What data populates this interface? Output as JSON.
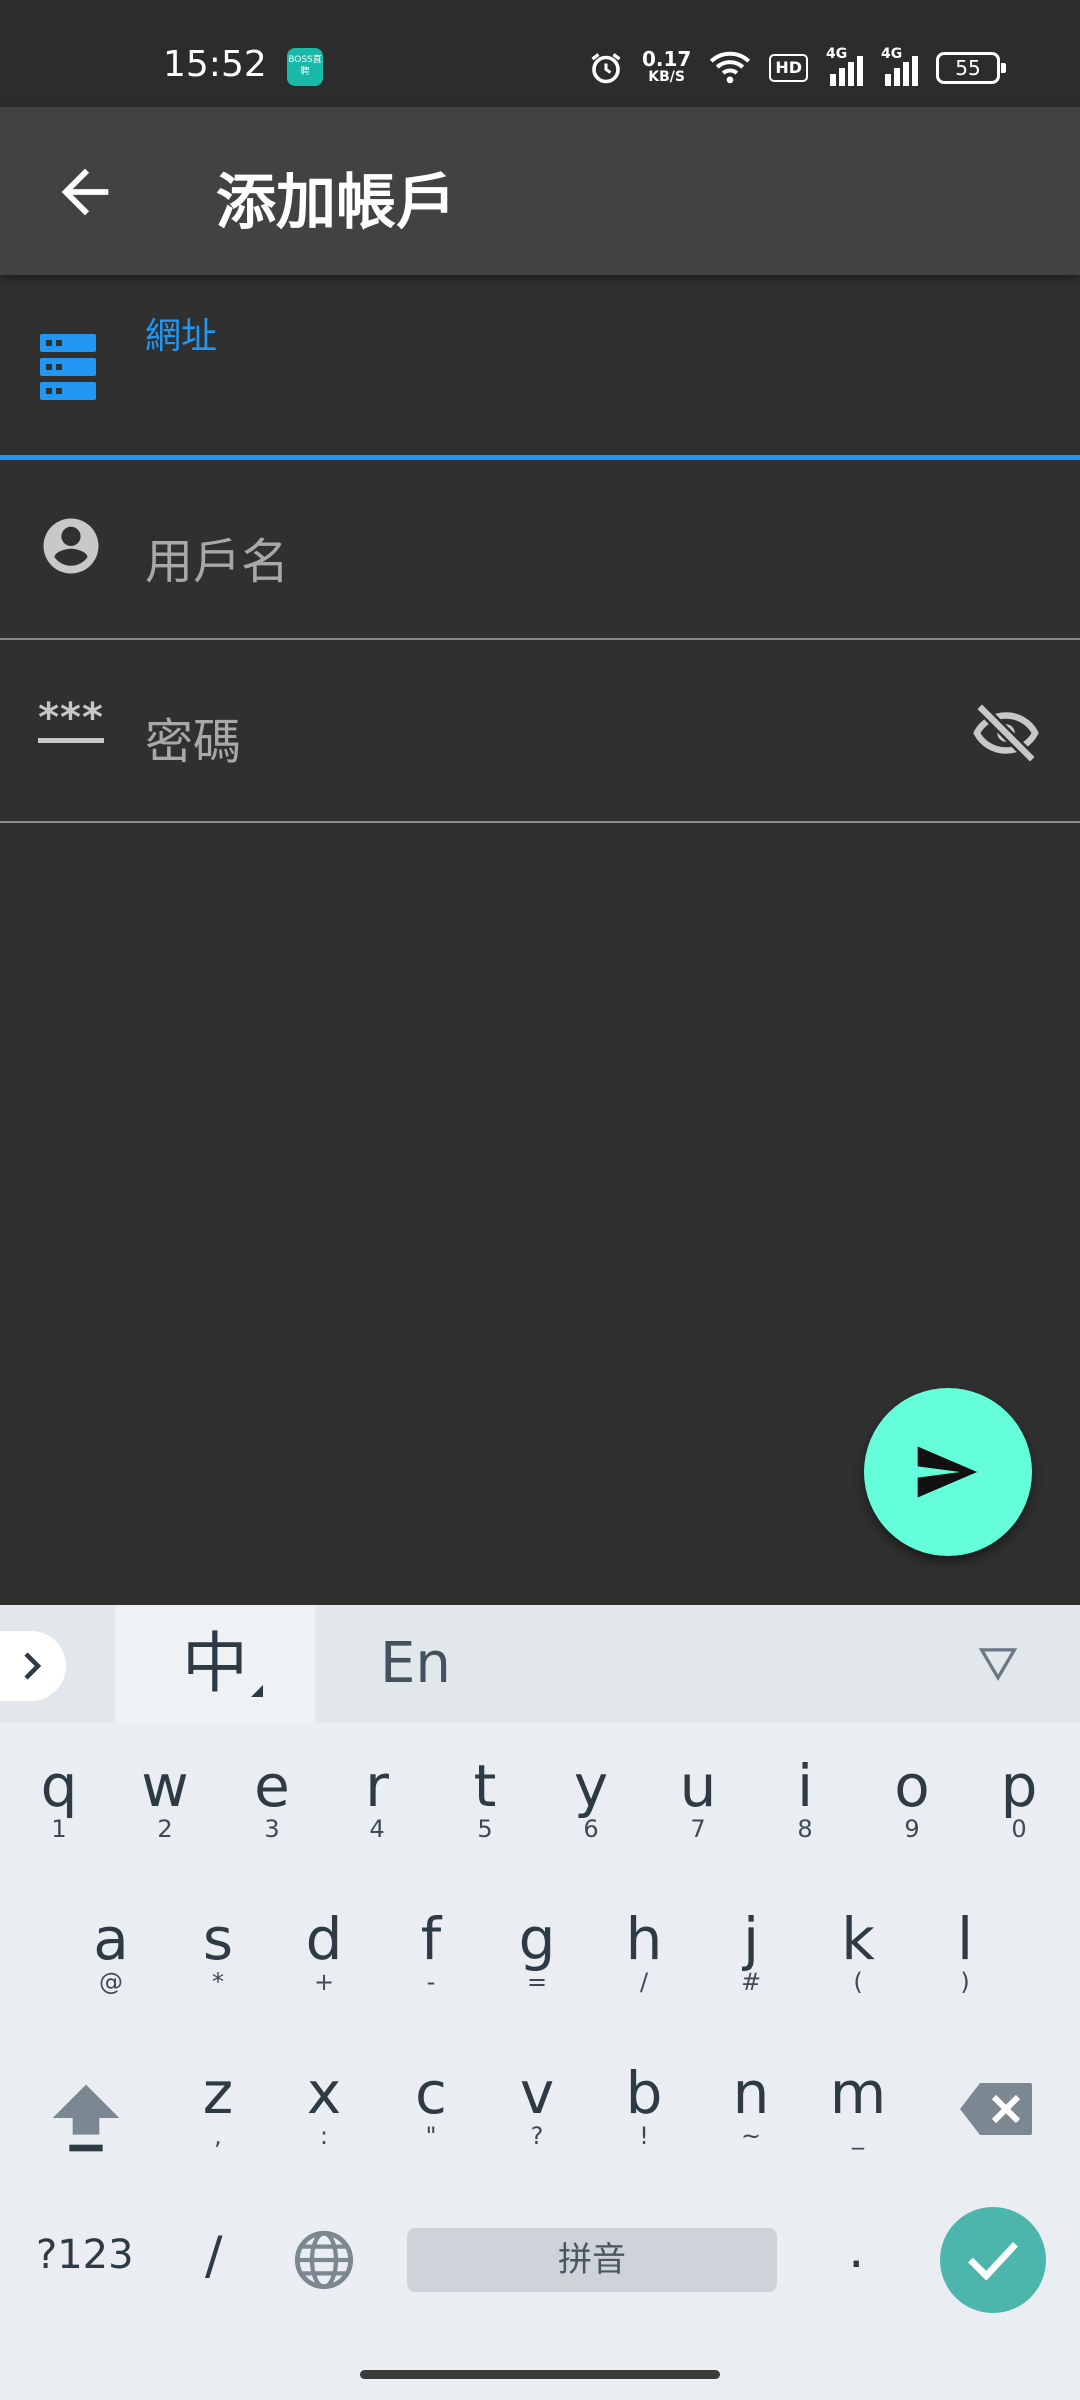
{
  "status_bar": {
    "time": "15:52",
    "app_icon_text": "BOSS直聘",
    "net_speed_value": "0.17",
    "net_speed_unit": "KB/S",
    "hd_label": "HD",
    "signal1_label": "4G",
    "signal2_label": "4G",
    "battery": "55"
  },
  "app_bar": {
    "title": "添加帳戶",
    "back_icon": "arrow-left-icon"
  },
  "form": {
    "url_label": "網址",
    "url_value": "",
    "username_placeholder": "用戶名",
    "password_placeholder": "密碼",
    "password_icon_text": "***",
    "accent_color": "#2196f3"
  },
  "fab": {
    "icon": "send-icon",
    "color": "#64ffda"
  },
  "keyboard": {
    "mode_zh": "中",
    "mode_en": "En",
    "row1": [
      {
        "key": "q",
        "sub": "1"
      },
      {
        "key": "w",
        "sub": "2"
      },
      {
        "key": "e",
        "sub": "3"
      },
      {
        "key": "r",
        "sub": "4"
      },
      {
        "key": "t",
        "sub": "5"
      },
      {
        "key": "y",
        "sub": "6"
      },
      {
        "key": "u",
        "sub": "7"
      },
      {
        "key": "i",
        "sub": "8"
      },
      {
        "key": "o",
        "sub": "9"
      },
      {
        "key": "p",
        "sub": "0"
      }
    ],
    "row2": [
      {
        "key": "a",
        "sub": "@"
      },
      {
        "key": "s",
        "sub": "*"
      },
      {
        "key": "d",
        "sub": "+"
      },
      {
        "key": "f",
        "sub": "-"
      },
      {
        "key": "g",
        "sub": "="
      },
      {
        "key": "h",
        "sub": "/"
      },
      {
        "key": "j",
        "sub": "#"
      },
      {
        "key": "k",
        "sub": "("
      },
      {
        "key": "l",
        "sub": ")"
      }
    ],
    "row3": [
      {
        "key": "z",
        "sub": ","
      },
      {
        "key": "x",
        "sub": ":"
      },
      {
        "key": "c",
        "sub": "\""
      },
      {
        "key": "v",
        "sub": "?"
      },
      {
        "key": "b",
        "sub": "!"
      },
      {
        "key": "n",
        "sub": "~"
      },
      {
        "key": "m",
        "sub": "_"
      }
    ],
    "symbols_label": "?123",
    "slash_label": "/",
    "space_label": "拼音",
    "period_label": ".",
    "enter_color": "#4db6ac"
  }
}
